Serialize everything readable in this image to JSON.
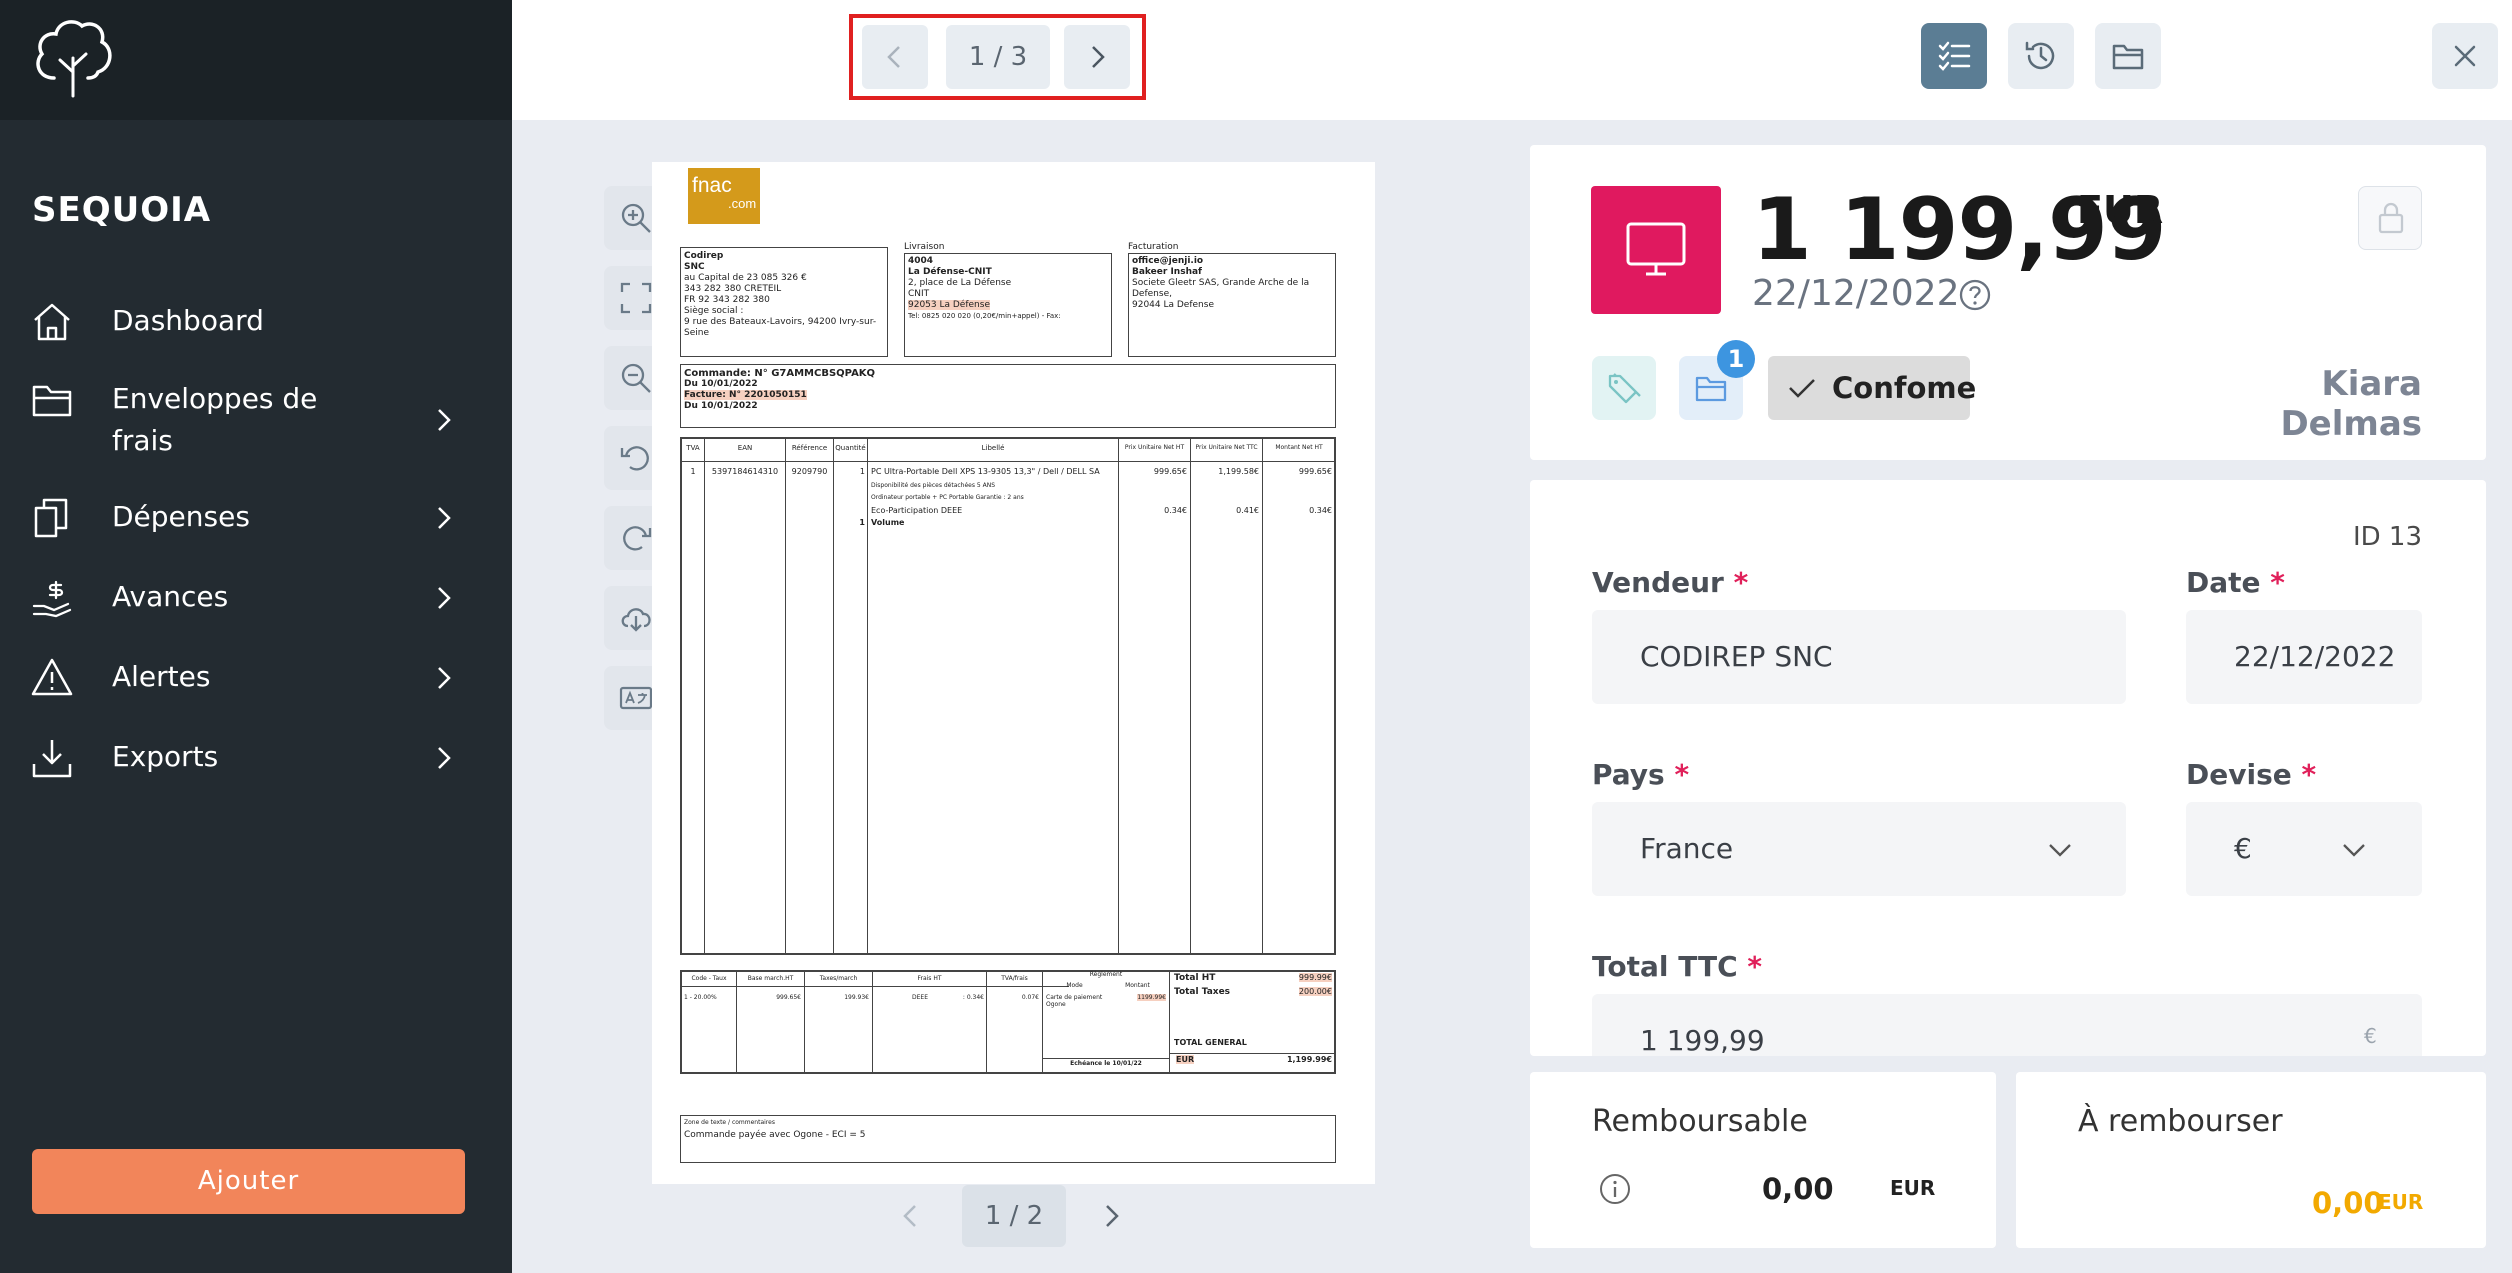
{
  "app": {
    "name": "SEQUOIA"
  },
  "sidebar": {
    "items": [
      {
        "label": "Dashboard",
        "icon": "home-icon",
        "has_submenu": false
      },
      {
        "label": "Enveloppes de",
        "label2": "frais",
        "icon": "folder-icon",
        "has_submenu": true
      },
      {
        "label": "Dépenses",
        "icon": "receipts-icon",
        "has_submenu": true
      },
      {
        "label": "Avances",
        "icon": "hand-dollar-icon",
        "has_submenu": true
      },
      {
        "label": "Alertes",
        "icon": "warning-icon",
        "has_submenu": true
      },
      {
        "label": "Exports",
        "icon": "download-icon",
        "has_submenu": true
      }
    ],
    "add_button": "Ajouter"
  },
  "topbar": {
    "pager": "1 / 3",
    "buttons": [
      "checklist-icon",
      "history-icon",
      "folder-icon"
    ],
    "close": "close-icon"
  },
  "document": {
    "pager": "1 / 2",
    "tools": [
      "zoom-in-icon",
      "fullscreen-icon",
      "zoom-out-icon",
      "rotate-left-icon",
      "rotate-right-icon",
      "download-icon",
      "translate-icon"
    ],
    "invoice": {
      "logo_line1": "fnac",
      "logo_line2": ".com",
      "seller": {
        "name": "Codirep",
        "line2": "SNC",
        "line3": "au Capital de 23 085 326 €",
        "line4": "343 282 380 CRETEIL",
        "line5": "FR 92 343 282 380",
        "line6": "Siège social :",
        "line7": "9 rue des Bateaux-Lavoirs, 94200 Ivry-sur-Seine"
      },
      "delivery": {
        "title": "Livraison",
        "line1": "4004",
        "line2": "La Défense-CNIT",
        "line3": "2, place de La Défense",
        "line4": "CNIT",
        "line5": "92053 La Défense",
        "line6": "Tel: 0825 020 020 (0,20€/min+appel) - Fax:"
      },
      "billing": {
        "title": "Facturation",
        "line1": "office@jenji.io",
        "line2": "Bakeer Inshaf",
        "line3": "Societe Gleetr SAS, Grande Arche de la Defense,",
        "line4": "92044 La Defense"
      },
      "order": {
        "line1": "Commande: N° G7AMMCBSQPAKQ",
        "line2": "Du 10/01/2022",
        "line3": "Facture: N° 2201050151",
        "line4": "Du 10/01/2022"
      },
      "table_headers": [
        "TVA",
        "EAN",
        "Référence",
        "Quantité",
        "Libellé",
        "Prix Unitaire Net HT",
        "Prix Unitaire Net TTC",
        "Montant Net HT"
      ],
      "row": {
        "tva": "1",
        "ean": "5397184614310",
        "ref": "9209790",
        "qty": "1",
        "label1": "PC Ultra-Portable Dell XPS 13-9305 13,3\"  / Dell / DELL SA",
        "label2": "Disponibilité des pièces détachées 5 ANS",
        "label3": "Ordinateur portable + PC Portable  Garantie : 2 ans",
        "label4": "Eco-Participation DEEE",
        "label5": "Volume",
        "qty2": "1",
        "pu_ht": "999.65€",
        "pu_ttc": "1,199.58€",
        "amount": "999.65€",
        "eco_ht": "0.34€",
        "eco_ttc": "0.41€",
        "eco_amount": "0.34€"
      },
      "totals": {
        "tax_headers": [
          "Code - Taux",
          "Base march.HT",
          "Taxes/march",
          "Frais HT",
          "TVA/frais"
        ],
        "tax_row": [
          "1 - 20.00%",
          "999.65€",
          "199.93€",
          "DEEE",
          ": 0.34€",
          "0.07€"
        ],
        "reglement": "Règlement",
        "mode": "Mode",
        "montant": "Montant",
        "pay_mode": "Carte de paiement Ogone",
        "pay_amount": "1199.99€",
        "echeance": "Echéance le 10/01/22",
        "total_ht_label": "Total HT",
        "total_ht": "999.99€",
        "total_taxes_label": "Total Taxes",
        "total_taxes": "200.00€",
        "total_general_label": "TOTAL GENERAL",
        "total_general_cur": "EUR",
        "total_general": "1,199.99€"
      },
      "comment_title": "Zone de texte / commentaires",
      "comment": "Commande payée avec Ogone - ECI = 5"
    }
  },
  "expense": {
    "amount": "1 199,99",
    "currency": "EUR",
    "date": "22/12/2022",
    "category_icon": "monitor-icon",
    "folder_count": "1",
    "status": "Confome",
    "owner": "Kiara Delmas",
    "id": "ID 13"
  },
  "form": {
    "vendeur_label": "Vendeur",
    "vendeur": "CODIREP SNC",
    "date_label": "Date",
    "date": "22/12/2022",
    "pays_label": "Pays",
    "pays": "France",
    "devise_label": "Devise",
    "devise": "€",
    "total_label": "Total TTC",
    "total": "1 199,99",
    "total_unit": "€",
    "required": "*"
  },
  "summary": {
    "remboursable_label": "Remboursable",
    "remboursable": "0,00",
    "remboursable_cur": "EUR",
    "a_rembourser_label": "À rembourser",
    "a_rembourser": "0,00",
    "a_rembourser_cur": "EUR"
  },
  "colors": {
    "sidebar": "#232b31",
    "accent": "#f2855a",
    "category": "#e0195f",
    "highlight": "#e02020",
    "refund": "#f2a900"
  }
}
